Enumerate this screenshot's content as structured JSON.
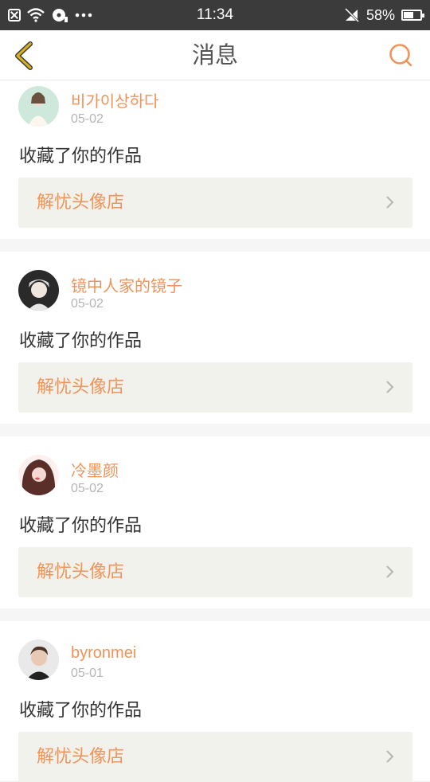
{
  "status_bar": {
    "time": "11:34",
    "battery": "58%",
    "battery_level": 0.58
  },
  "header": {
    "title": "消息"
  },
  "messages": [
    {
      "username": "비가이상하다",
      "date": "05-02",
      "action": "收藏了你的作品",
      "target": "解忧头像店"
    },
    {
      "username": "镜中人家的镜子",
      "date": "05-02",
      "action": "收藏了你的作品",
      "target": "解忧头像店"
    },
    {
      "username": "冷墨颜",
      "date": "05-02",
      "action": "收藏了你的作品",
      "target": "解忧头像店"
    },
    {
      "username": "byronmei",
      "date": "05-01",
      "action": "收藏了你的作品",
      "target": "解忧头像店"
    }
  ],
  "colors": {
    "accent": "#f0935a",
    "status_bar": "#3b3b3b",
    "link_bg": "#f2f2ec",
    "back_icon": "#d8b21c"
  }
}
